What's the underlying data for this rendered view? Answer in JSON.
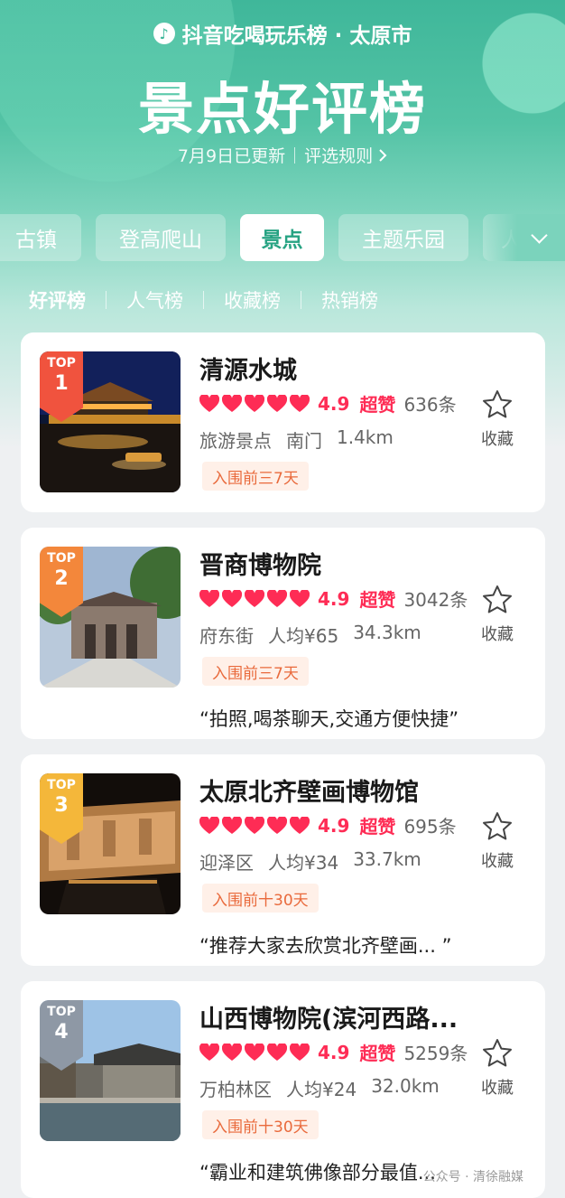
{
  "header": {
    "brand": "抖音吃喝玩乐榜 · 太原市",
    "title": "景点好评榜",
    "updated": "7月9日已更新",
    "rules": "评选规则",
    "colors": {
      "accent": "#27a383",
      "red": "#fe2c55",
      "tag": "#e96a3c"
    }
  },
  "category_tabs": [
    {
      "label": "古镇"
    },
    {
      "label": "登高爬山"
    },
    {
      "label": "景点"
    },
    {
      "label": "主题乐园"
    },
    {
      "label": "人"
    }
  ],
  "sub_tabs": [
    {
      "label": "好评榜"
    },
    {
      "label": "人气榜"
    },
    {
      "label": "收藏榜"
    },
    {
      "label": "热销榜"
    }
  ],
  "items": [
    {
      "top": "TOP",
      "rank": "1",
      "name": "清源水城",
      "score": "4.9",
      "praise": "超赞",
      "count": "636条",
      "meta": [
        "旅游景点",
        "南门",
        "1.4km"
      ],
      "tag": "入围前三7天",
      "quote": "",
      "fav": "收藏",
      "badge_color": "#f0533e"
    },
    {
      "top": "TOP",
      "rank": "2",
      "name": "晋商博物院",
      "score": "4.9",
      "praise": "超赞",
      "count": "3042条",
      "meta": [
        "府东街",
        "人均¥65",
        "34.3km"
      ],
      "tag": "入围前三7天",
      "quote": "“拍照,喝茶聊天,交通方便快捷”",
      "fav": "收藏",
      "badge_color": "#f3873b"
    },
    {
      "top": "TOP",
      "rank": "3",
      "name": "太原北齐壁画博物馆",
      "score": "4.9",
      "praise": "超赞",
      "count": "695条",
      "meta": [
        "迎泽区",
        "人均¥34",
        "33.7km"
      ],
      "tag": "入围前十30天",
      "quote": "“推荐大家去欣赏北齐壁画... ”",
      "fav": "收藏",
      "badge_color": "#f4b73a"
    },
    {
      "top": "TOP",
      "rank": "4",
      "name": "山西博物院(滨河西路...",
      "score": "4.9",
      "praise": "超赞",
      "count": "5259条",
      "meta": [
        "万柏林区",
        "人均¥24",
        "32.0km"
      ],
      "tag": "入围前十30天",
      "quote": "“霸业和建筑佛像部分最值...",
      "fav": "收藏",
      "badge_color": "#8e98a5"
    }
  ],
  "watermark": "公众号 · 清徐融媒"
}
